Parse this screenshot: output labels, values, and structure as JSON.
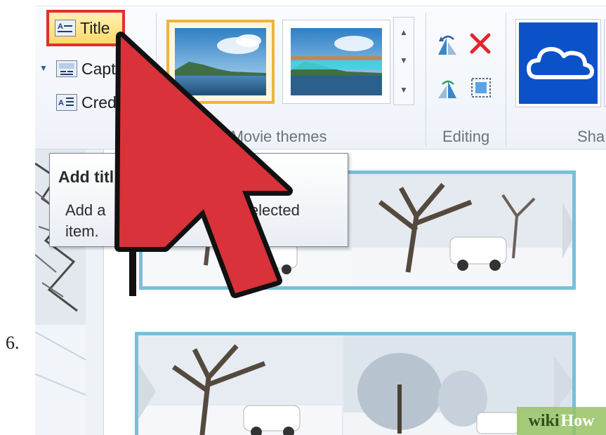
{
  "step_number": "6.",
  "ribbon": {
    "buttons": {
      "title": "Title",
      "caption": "Capt",
      "credits": "Cred"
    },
    "groups": {
      "autothemes": "utoMovie themes",
      "editing": "Editing",
      "share": "Sha"
    }
  },
  "tooltip": {
    "title": "Add titl",
    "body_line1_a": "Add a",
    "body_line1_b": "re the selected",
    "body_line2": "item."
  },
  "watermark": {
    "wiki": "wiki",
    "how": "How"
  },
  "colors": {
    "highlight_border": "#e52e2e",
    "cursor_fill": "#d9323a",
    "strip_border": "#79bfd9",
    "onedrive_tile": "#0b52c9",
    "selected_theme_border": "#f0b43c"
  },
  "icons": {
    "title": "title-text-icon",
    "caption": "caption-text-icon",
    "credits": "credits-text-icon",
    "rotate_left": "rotate-left-icon",
    "remove": "remove-x-icon",
    "rotate_right": "rotate-right-icon",
    "select_all": "select-all-icon",
    "onedrive": "onedrive-cloud-icon",
    "cursor": "mouse-pointer-icon"
  }
}
